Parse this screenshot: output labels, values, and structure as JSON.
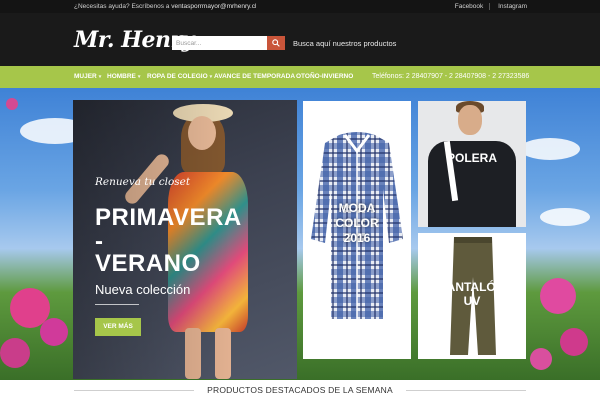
{
  "topbar": {
    "help_text": "¿Necesitas ayuda? Escríbenos a",
    "help_email": "ventasporrmayor@mrhenry.cl",
    "links": [
      "Facebook",
      "Instagram"
    ]
  },
  "header": {
    "logo": "Mr. Henry",
    "search_placeholder": "Buscar...",
    "tagline": "Busca aquí nuestros productos"
  },
  "nav": {
    "items": [
      "MUJER",
      "HOMBRE",
      "ROPA DE COLEGIO",
      "AVANCE DE TEMPORADA",
      "OTOÑO-INVIERNO"
    ],
    "phones": "Teléfonos: 2 28407907 - 2 28407908 - 2 27323586"
  },
  "hero": {
    "main": {
      "script": "Renueva tu closet",
      "title_line1": "PRIMAVERA",
      "dash": "-",
      "title_line2": "VERANO",
      "subtitle": "Nueva colección",
      "button": "VER MÁS"
    },
    "tiles": [
      {
        "label_line1": "MODA",
        "label_line2": "COLOR",
        "label_line3": "2016"
      },
      {
        "label": "POLERA"
      },
      {
        "label_line1": "PANTALÓN",
        "label_line2": "UV"
      }
    ]
  },
  "section": {
    "title": "PRODUCTOS DESTACADOS DE LA SEMANA"
  },
  "colors": {
    "brand_green": "#a6c64a",
    "header_bg": "#1a1a1a",
    "search_button": "#c9553a"
  }
}
